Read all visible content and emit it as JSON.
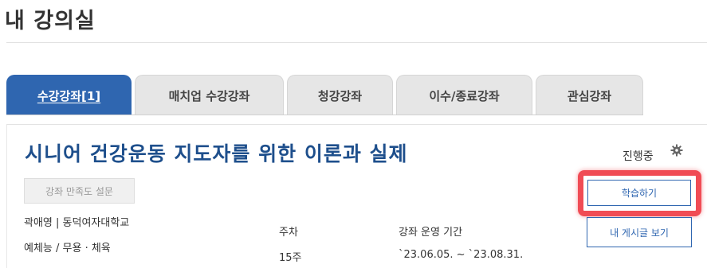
{
  "page": {
    "title": "내 강의실"
  },
  "tabs": [
    {
      "label": "수강강좌[1]",
      "active": true
    },
    {
      "label": "매치업 수강강좌",
      "active": false
    },
    {
      "label": "청강강좌",
      "active": false
    },
    {
      "label": "이수/종료강좌",
      "active": false
    },
    {
      "label": "관심강좌",
      "active": false
    }
  ],
  "course": {
    "title": "시니어 건강운동 지도자를 위한 이론과 실제",
    "status": "진행중",
    "survey_button": "강좌 만족도 설문",
    "study_button": "학습하기",
    "posts_button": "내 게시글 보기",
    "instructor": "곽애영 | 동덕여자대학교",
    "category": "예체능 / 무용 · 체육",
    "weeks_label": "주차",
    "weeks_value": "15주",
    "period_label": "강좌 운영 기간",
    "period_value": "`23.06.05. ~ `23.08.31."
  },
  "colors": {
    "accent": "#2f66b0",
    "title_blue": "#1e4f8c",
    "highlight": "#f04c55",
    "tab_inactive": "#e6e6e6"
  },
  "icons": {
    "settings": "gear-icon"
  }
}
